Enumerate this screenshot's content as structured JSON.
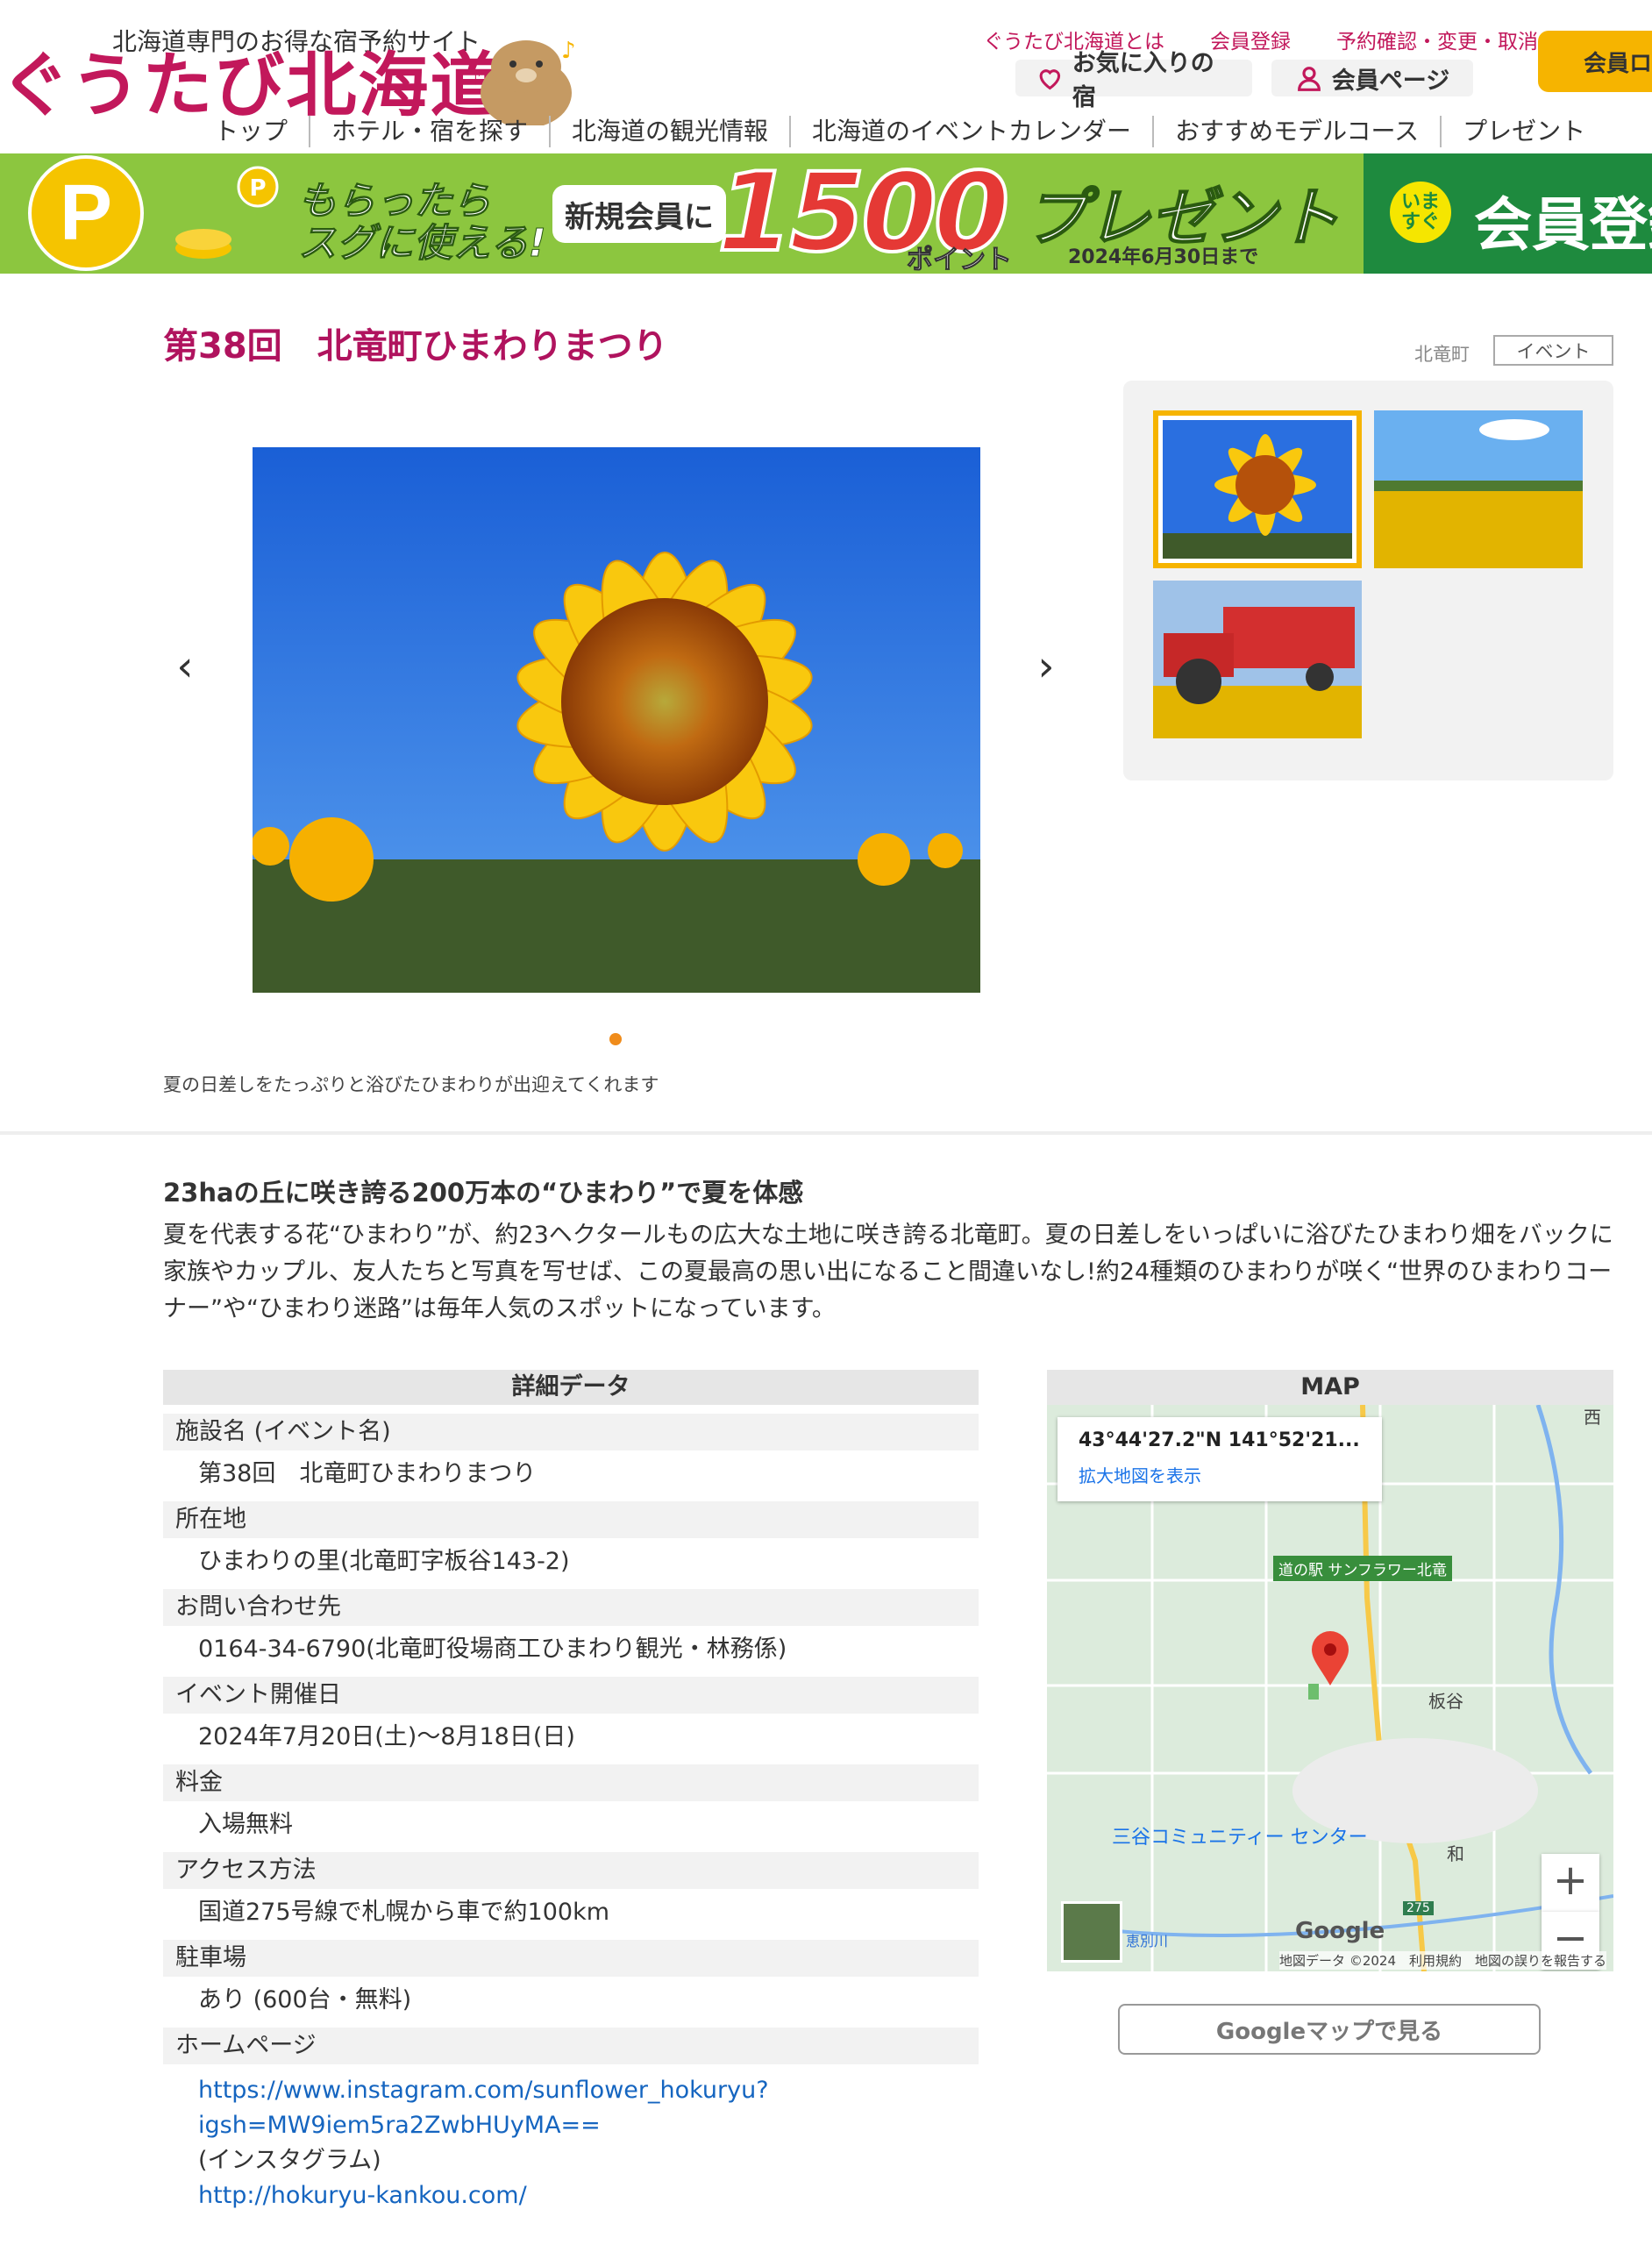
{
  "header": {
    "tagline": "北海道専門のお得な宿予約サイト",
    "logo_text": "ぐうたび北海道",
    "top_links": [
      "ぐうたび北海道とは",
      "会員登録",
      "予約確認・変更・取消"
    ],
    "favorites_label": "お気に入りの宿",
    "member_page_label": "会員ページ",
    "login_label": "会員ログイン",
    "brand_color": "#c2185b",
    "accent_color": "#f6b400"
  },
  "nav": [
    "トップ",
    "ホテル・宿を探す",
    "北海道の観光情報",
    "北海道のイベントカレンダー",
    "おすすめモデルコース",
    "プレゼント"
  ],
  "banner": {
    "line1": "もらったら",
    "line2": "スグに使える!",
    "new_member": "新規会員に",
    "amount": "1500",
    "unit": "ポイント",
    "present": "プレゼント",
    "deadline": "2024年6月30日まで",
    "now": "いま すぐ",
    "register": "会員登録"
  },
  "event": {
    "title": "第38回　北竜町ひまわりまつり",
    "area": "北竜町",
    "category": "イベント",
    "caption": "夏の日差しをたっぷりと浴びたひまわりが出迎えてくれます",
    "slide_count": 1
  },
  "description": {
    "lead": "23haの丘に咲き誇る200万本の“ひまわり”で夏を体感",
    "body": "夏を代表する花“ひまわり”が、約23ヘクタールもの広大な土地に咲き誇る北竜町。夏の日差しをいっぱいに浴びたひまわり畑をバックに家族やカップル、友人たちと写真を写せば、この夏最高の思い出になること間違いなし!約24種類のひまわりが咲く“世界のひまわりコーナー”や“ひまわり迷路”は毎年人気のスポットになっています。"
  },
  "details": {
    "heading": "詳細データ",
    "rows": [
      {
        "label": "施設名 (イベント名)",
        "value": "第38回　北竜町ひまわりまつり"
      },
      {
        "label": "所在地",
        "value": "ひまわりの里(北竜町字板谷143-2)"
      },
      {
        "label": "お問い合わせ先",
        "value": "0164-34-6790(北竜町役場商工ひまわり観光・林務係)"
      },
      {
        "label": "イベント開催日",
        "value": "2024年7月20日(土)～8月18日(日)"
      },
      {
        "label": "料金",
        "value": "入場無料"
      },
      {
        "label": "アクセス方法",
        "value": "国道275号線で札幌から車で約100km"
      },
      {
        "label": "駐車場",
        "value": "あり (600台・無料)"
      }
    ],
    "homepage_label": "ホームページ",
    "homepage_link1a": "https://www.instagram.com/sunflower_hokuryu?",
    "homepage_link1b": "igsh=MW9iem5ra2ZwbHUyMA==",
    "homepage_note": "(インスタグラム)",
    "homepage_link2": "http://hokuryu-kankou.com/"
  },
  "map": {
    "heading": "MAP",
    "coord": "43°44'27.2\"N 141°52'21...",
    "enlarge": "拡大地図を表示",
    "station": "道の駅 サンフラワー北竜",
    "label_itaya": "板谷",
    "label_wa": "和",
    "label_nishi": "西",
    "poi": "三谷コミュニティー センター",
    "river": "恵別川",
    "route": "275",
    "google": "Google",
    "attribution": "地図データ ©2024　利用規約　地図の誤りを報告する",
    "button": "Googleマップで見る"
  }
}
